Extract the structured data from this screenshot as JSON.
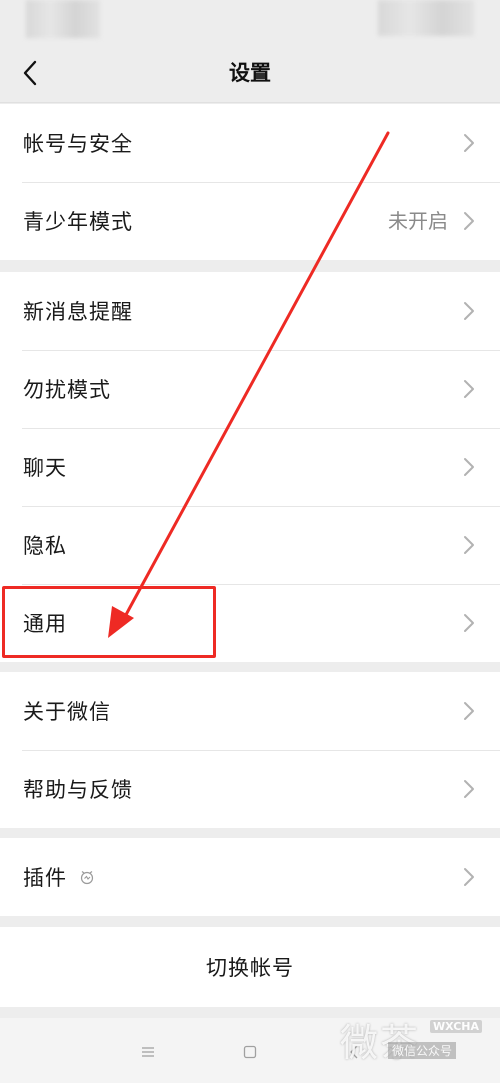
{
  "nav": {
    "title": "设置"
  },
  "groups": [
    {
      "items": [
        {
          "label": "帐号与安全",
          "value": ""
        },
        {
          "label": "青少年模式",
          "value": "未开启"
        }
      ]
    },
    {
      "items": [
        {
          "label": "新消息提醒",
          "value": ""
        },
        {
          "label": "勿扰模式",
          "value": ""
        },
        {
          "label": "聊天",
          "value": ""
        },
        {
          "label": "隐私",
          "value": ""
        },
        {
          "label": "通用",
          "value": ""
        }
      ]
    },
    {
      "items": [
        {
          "label": "关于微信",
          "value": ""
        },
        {
          "label": "帮助与反馈",
          "value": ""
        }
      ]
    },
    {
      "items": [
        {
          "label": "插件",
          "value": "",
          "icon": "plugin-icon"
        }
      ]
    }
  ],
  "switch_account": {
    "label": "切换帐号"
  },
  "system_nav": {
    "menu_icon": "menu-icon",
    "home_icon": "home-icon",
    "back_icon": "back-icon"
  },
  "watermark": {
    "main": "微茶",
    "tag": "WXCHA",
    "sub": "微信公众号"
  },
  "colors": {
    "background": "#ededed",
    "card": "#ffffff",
    "annotation": "#ee2a24",
    "secondary_text": "#8a8a8a"
  }
}
